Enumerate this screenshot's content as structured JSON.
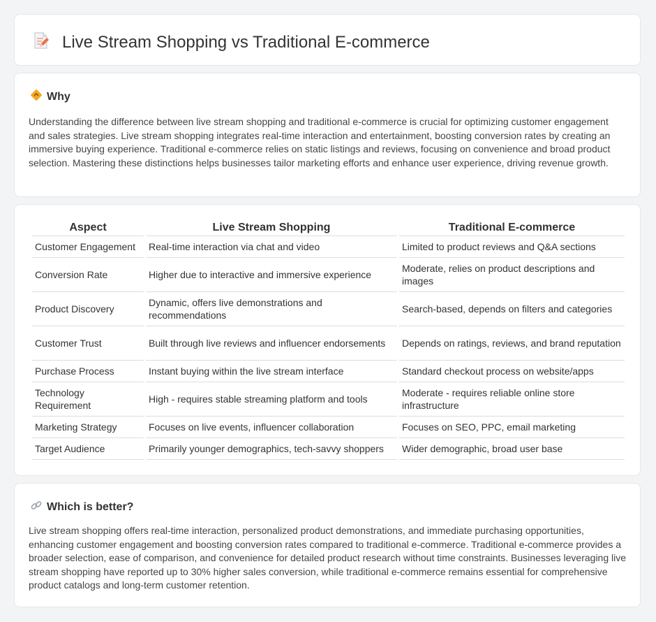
{
  "header": {
    "title": "Live Stream Shopping vs Traditional E-commerce",
    "icon": "edit-document-icon"
  },
  "why": {
    "title": "Why",
    "icon": "warning-sign-icon",
    "text": "Understanding the difference between live stream shopping and traditional e-commerce is crucial for optimizing customer engagement and sales strategies. Live stream shopping integrates real-time interaction and entertainment, boosting conversion rates by creating an immersive buying experience. Traditional e-commerce relies on static listings and reviews, focusing on convenience and broad product selection. Mastering these distinctions helps businesses tailor marketing efforts and enhance user experience, driving revenue growth."
  },
  "table": {
    "headers": [
      "Aspect",
      "Live Stream Shopping",
      "Traditional E-commerce"
    ],
    "rows": [
      [
        "Customer Engagement",
        "Real-time interaction via chat and video",
        "Limited to product reviews and Q&A sections"
      ],
      [
        "Conversion Rate",
        "Higher due to interactive and immersive experience",
        "Moderate, relies on product descriptions and images"
      ],
      [
        "Product Discovery",
        "Dynamic, offers live demonstrations and recommendations",
        "Search-based, depends on filters and categories"
      ],
      [
        "Customer Trust",
        "Built through live reviews and influencer endorsements",
        "Depends on ratings, reviews, and brand reputation"
      ],
      [
        "Purchase Process",
        "Instant buying within the live stream interface",
        "Standard checkout process on website/apps"
      ],
      [
        "Technology Requirement",
        "High - requires stable streaming platform and tools",
        "Moderate - requires reliable online store infrastructure"
      ],
      [
        "Marketing Strategy",
        "Focuses on live events, influencer collaboration",
        "Focuses on SEO, PPC, email marketing"
      ],
      [
        "Target Audience",
        "Primarily younger demographics, tech-savvy shoppers",
        "Wider demographic, broad user base"
      ]
    ]
  },
  "better": {
    "title": "Which is better?",
    "icon": "link-icon",
    "text": "Live stream shopping offers real-time interaction, personalized product demonstrations, and immediate purchasing opportunities, enhancing customer engagement and boosting conversion rates compared to traditional e-commerce. Traditional e-commerce provides a broader selection, ease of comparison, and convenience for detailed product research without time constraints. Businesses leveraging live stream shopping have reported up to 30% higher sales conversion, while traditional e-commerce remains essential for comprehensive product catalogs and long-term customer retention."
  }
}
